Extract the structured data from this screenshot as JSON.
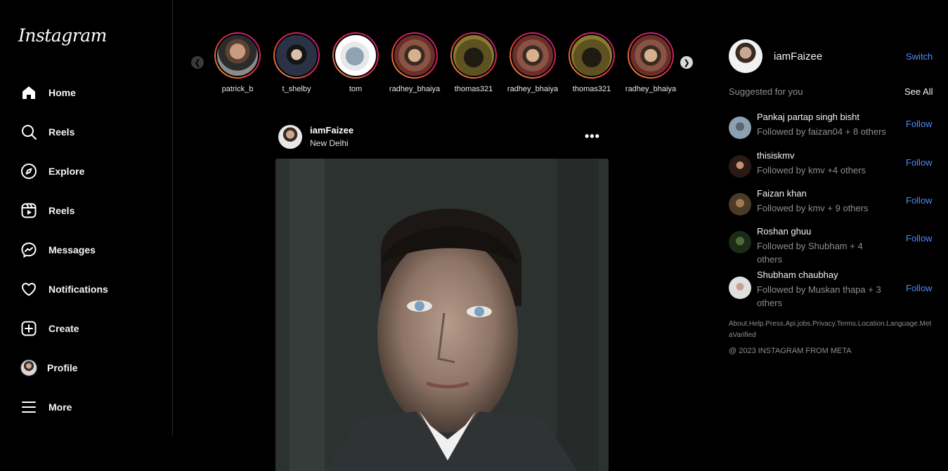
{
  "brand": "Instagram",
  "nav": [
    {
      "label": "Home",
      "icon": "home-icon"
    },
    {
      "label": "Reels",
      "icon": "search-icon"
    },
    {
      "label": "Explore",
      "icon": "compass-icon"
    },
    {
      "label": "Reels",
      "icon": "reels-icon"
    },
    {
      "label": "Messages",
      "icon": "messenger-icon"
    },
    {
      "label": "Notifications",
      "icon": "heart-icon"
    },
    {
      "label": "Create",
      "icon": "plus-square-icon"
    },
    {
      "label": "Profile",
      "icon": "avatar"
    },
    {
      "label": "More",
      "icon": "hamburger-icon"
    }
  ],
  "stories": [
    {
      "name": "patrick_b"
    },
    {
      "name": "t_shelby"
    },
    {
      "name": "tom"
    },
    {
      "name": "radhey_bhaiya"
    },
    {
      "name": "thomas321"
    },
    {
      "name": "radhey_bhaiya"
    },
    {
      "name": "thomas321"
    },
    {
      "name": "radhey_bhaiya"
    }
  ],
  "post": {
    "username": "iamFaizee",
    "location": "New Delhi",
    "more": "•••"
  },
  "me": {
    "username": "iamFaizee",
    "switch_label": "Switch"
  },
  "suggestions": {
    "heading": "Suggested for you",
    "see_all": "See All",
    "follow_label": "Follow",
    "items": [
      {
        "name": "Pankaj partap singh bisht",
        "sub": "Followed by faizan04 + 8 others"
      },
      {
        "name": "thisiskmv",
        "sub": "Followed by kmv +4 others"
      },
      {
        "name": "Faizan khan",
        "sub": "Followed by kmv + 9 others"
      },
      {
        "name": "Roshan ghuu",
        "sub": "Followed by Shubham + 4 others"
      },
      {
        "name": "Shubham chaubhay",
        "sub": "Followed by Muskan thapa + 3 others"
      }
    ]
  },
  "footer": {
    "links": "About.Help.Press.Api.jobs.Privacy.Terms.Location.Language.MetaVarified",
    "copyright": "@ 2023 INSTAGRAM FROM META"
  }
}
